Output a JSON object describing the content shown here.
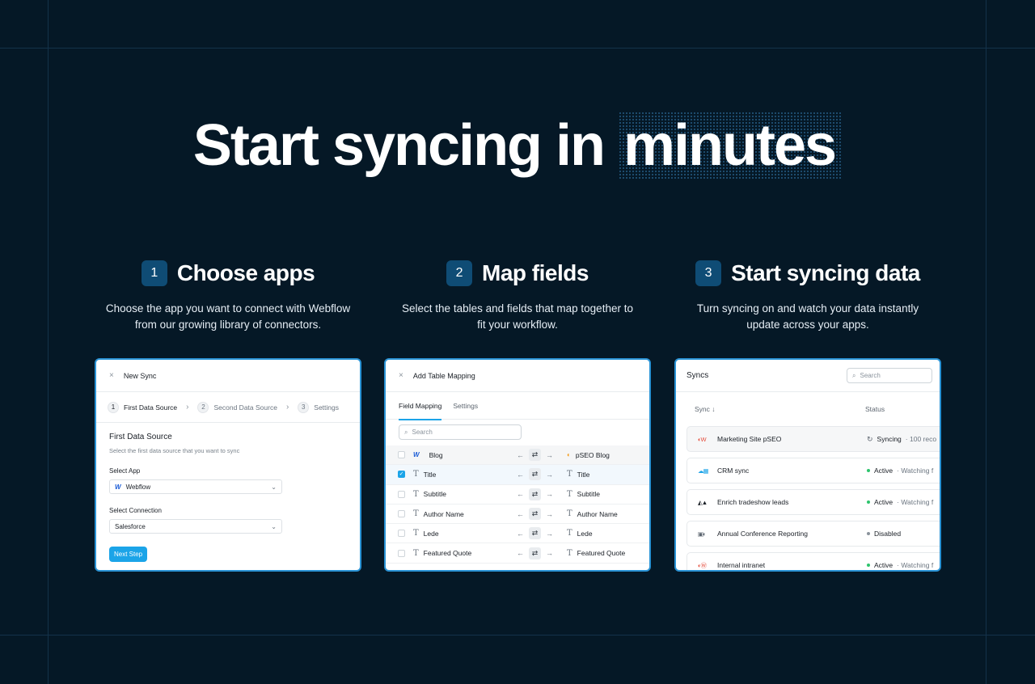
{
  "headline": {
    "part1": "Start syncing in",
    "accent": "minutes"
  },
  "steps": [
    {
      "num": "1",
      "title": "Choose apps",
      "desc": "Choose the app you want to connect with Webflow from our growing library of connectors."
    },
    {
      "num": "2",
      "title": "Map fields",
      "desc": "Select the tables and fields that map together to fit your workflow."
    },
    {
      "num": "3",
      "title": "Start syncing data",
      "desc": "Turn syncing on and watch your data instantly update across your apps."
    }
  ],
  "card1": {
    "close": "×",
    "title": "New Sync",
    "stepper": [
      {
        "n": "1",
        "label": "First Data Source"
      },
      {
        "n": "2",
        "label": "Second Data Source"
      },
      {
        "n": "3",
        "label": "Settings"
      }
    ],
    "heading": "First Data Source",
    "sub": "Select the first data source that you want to sync",
    "select_app_label": "Select App",
    "select_app_value": "Webflow",
    "select_conn_label": "Select Connection",
    "select_conn_value": "Salesforce",
    "next_button": "Next Step"
  },
  "card2": {
    "close": "×",
    "title": "Add Table Mapping",
    "tabs": [
      "Field Mapping",
      "Settings"
    ],
    "search_placeholder": "Search",
    "header_row": {
      "left": "Blog",
      "right": "pSEO Blog"
    },
    "rows": [
      {
        "left": "Title",
        "right": "Title",
        "checked": true
      },
      {
        "left": "Subtitle",
        "right": "Subtitle",
        "checked": false
      },
      {
        "left": "Author Name",
        "right": "Author Name",
        "checked": false
      },
      {
        "left": "Lede",
        "right": "Lede",
        "checked": false
      },
      {
        "left": "Featured Quote",
        "right": "Featured Quote",
        "checked": false
      }
    ]
  },
  "card3": {
    "title": "Syncs",
    "search_placeholder": "Search",
    "col_sync": "Sync ↓",
    "col_status": "Status",
    "rows": [
      {
        "name": "Marketing Site pSEO",
        "status": "Syncing",
        "detail": "· 100 reco",
        "kind": "syncing"
      },
      {
        "name": "CRM sync",
        "status": "Active",
        "detail": "· Watching f",
        "kind": "active"
      },
      {
        "name": "Enrich tradeshow leads",
        "status": "Active",
        "detail": "· Watching f",
        "kind": "active"
      },
      {
        "name": "Annual Conference Reporting",
        "status": "Disabled",
        "detail": "",
        "kind": "disabled"
      },
      {
        "name": "Internal intranet",
        "status": "Active",
        "detail": "· Watching f",
        "kind": "active"
      }
    ]
  },
  "colors": {
    "background": "#051826",
    "accent": "#1ba4e8",
    "step_badge": "#0f4c75",
    "active": "#2ec46d"
  }
}
